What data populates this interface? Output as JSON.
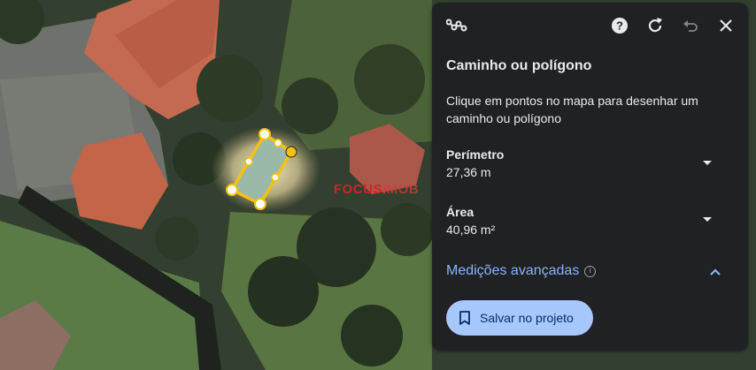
{
  "map": {
    "watermark": {
      "part1": "FOCUS",
      "part2": "IMOB"
    }
  },
  "panel": {
    "header_icons": {
      "measure": "measure-path-icon",
      "help": "help-icon",
      "refresh": "refresh-icon",
      "undo": "undo-icon",
      "close": "close-icon"
    },
    "title": "Caminho ou polígono",
    "description": "Clique em pontos no mapa para desenhar um caminho ou polígono",
    "perimeter": {
      "label": "Perímetro",
      "value": "27,36 m"
    },
    "area": {
      "label": "Área",
      "value": "40,96 m²"
    },
    "advanced": {
      "label": "Medições avançadas",
      "info_icon": "i"
    },
    "save_button": {
      "label": "Salvar no projeto",
      "icon": "bookmark-icon"
    },
    "colors": {
      "panel_bg": "#202124",
      "accent": "#8ab4f8",
      "button_bg": "#a8c7fa",
      "button_text": "#062e6f",
      "polygon": "#f4c20d"
    }
  }
}
